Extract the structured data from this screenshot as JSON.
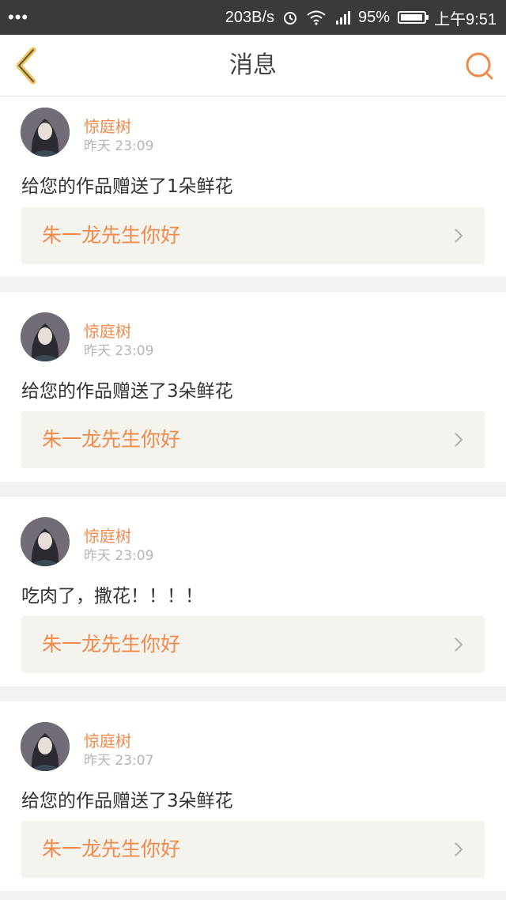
{
  "status_bar": {
    "left_icon": "more-dots",
    "net_speed": "203B/s",
    "battery_percent": "95%",
    "time": "上午9:51"
  },
  "nav": {
    "title": "消息",
    "back_icon": "chevron-left",
    "search_icon": "search"
  },
  "colors": {
    "accent": "#f08a4b",
    "back_stroke": "#f2c14e",
    "link_background": "#f4f3ee"
  },
  "messages": [
    {
      "user": "惊庭树",
      "time": "昨天 23:09",
      "text": "给您的作品赠送了1朵鲜花",
      "work_title": "朱一龙先生你好"
    },
    {
      "user": "惊庭树",
      "time": "昨天 23:09",
      "text": "给您的作品赠送了3朵鲜花",
      "work_title": "朱一龙先生你好"
    },
    {
      "user": "惊庭树",
      "time": "昨天 23:09",
      "text": "吃肉了，撒花！！！！",
      "work_title": "朱一龙先生你好"
    },
    {
      "user": "惊庭树",
      "time": "昨天 23:07",
      "text": "给您的作品赠送了3朵鲜花",
      "work_title": "朱一龙先生你好"
    }
  ]
}
